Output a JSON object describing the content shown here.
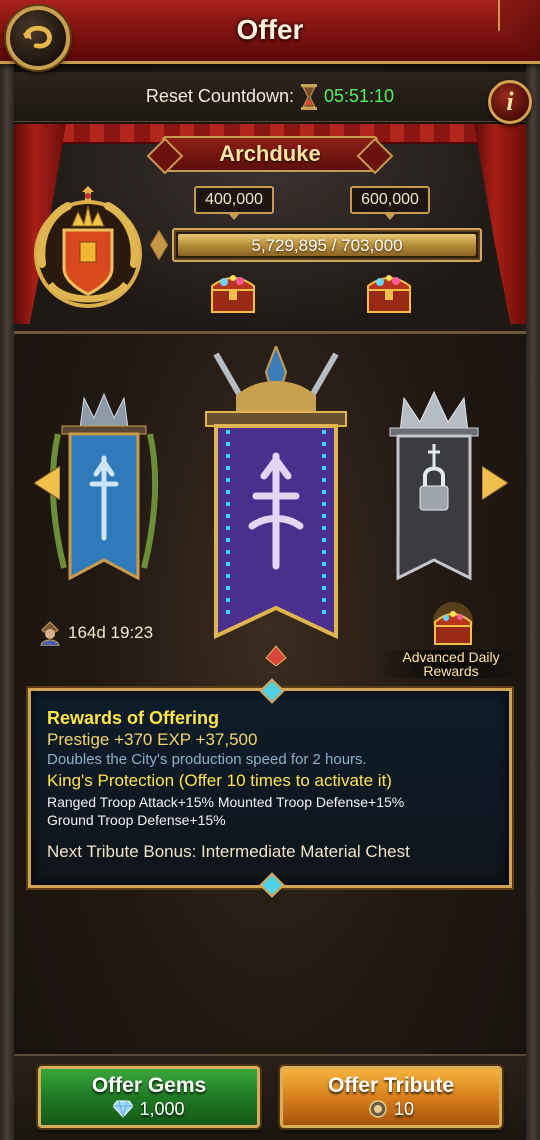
{
  "header": {
    "title": "Offer"
  },
  "reset": {
    "label": "Reset Countdown:",
    "countdown": "05:51:10"
  },
  "rank": {
    "name": "Archduke"
  },
  "progress": {
    "milestones": [
      "400,000",
      "600,000"
    ],
    "text": "5,729,895 / 703,000",
    "fill": 1.0
  },
  "banners": {
    "timer": "164d 19:23",
    "advanced_rewards_label": "Advanced Daily Rewards",
    "advanced_rewards_line1": "Advanced Daily",
    "advanced_rewards_line2": "Rewards"
  },
  "rewards": {
    "title": "Rewards of Offering",
    "prestige": "Prestige +370 EXP +37,500",
    "description": "Doubles the City's production speed for 2 hours.",
    "kings_protection": "King's Protection (Offer 10 times to activate it)",
    "bonus_line1": "Ranged Troop Attack+15% Mounted Troop Defense+15%",
    "bonus_line2": "Ground Troop Defense+15%",
    "next_tribute": "Next Tribute Bonus: Intermediate Material Chest"
  },
  "buttons": {
    "offer_gems_label": "Offer Gems",
    "offer_gems_cost": "1,000",
    "offer_tribute_label": "Offer Tribute",
    "offer_tribute_cost": "10"
  },
  "colors": {
    "countdown": "#57ef5f",
    "reward_highlight": "#ffe44a",
    "gold_border": "#d1a452",
    "green_button": "#1f7a23",
    "orange_button": "#d9801c"
  }
}
